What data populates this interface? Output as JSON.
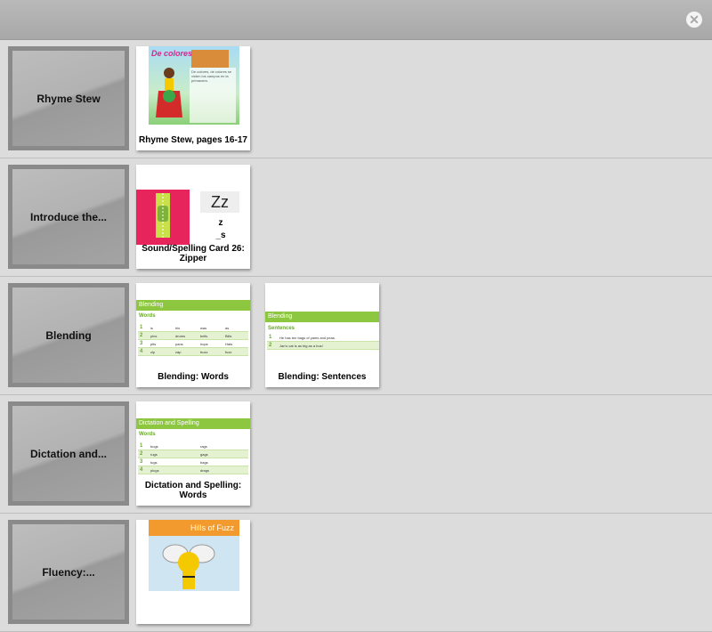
{
  "header": {
    "close_icon": "close-icon"
  },
  "rows": [
    {
      "section": "Rhyme Stew",
      "cards": [
        {
          "caption": "Rhyme Stew, pages 16-17",
          "thumb_title": "De colores"
        }
      ]
    },
    {
      "section": "Introduce the...",
      "cards": [
        {
          "caption": "Sound/Spelling Card 26: Zipper",
          "zz": "Zz",
          "letter": "z",
          "blank": "_s"
        }
      ]
    },
    {
      "section": "Blending",
      "cards": [
        {
          "caption": "Blending: Words",
          "thumb_head": "Blending",
          "thumb_sub": "Words",
          "table": [
            [
              "1",
              "is",
              "his",
              "was",
              "as"
            ],
            [
              "2",
              "pins",
              "drums",
              "bells",
              "Bills"
            ],
            [
              "3",
              "pits",
              "pans",
              "hops",
              "Hats"
            ],
            [
              "4",
              "zip",
              "zap",
              "buzz",
              "fuzz"
            ]
          ]
        },
        {
          "caption": "Blending: Sentences",
          "thumb_head": "Blending",
          "thumb_sub": "Sentences",
          "table": [
            [
              "1",
              "He has ten bags of yams and peas."
            ],
            [
              "2",
              "Jan's cat is as big as a bus!"
            ]
          ]
        }
      ]
    },
    {
      "section": "Dictation and...",
      "cards": [
        {
          "caption": "Dictation and Spelling: Words",
          "thumb_head": "Dictation and Spelling",
          "thumb_sub": "Words",
          "table": [
            [
              "1",
              "bugs",
              "rags"
            ],
            [
              "2",
              "rugs",
              "gags"
            ],
            [
              "3",
              "tugs",
              "bags"
            ],
            [
              "4",
              "plugs",
              "drags"
            ]
          ]
        }
      ]
    },
    {
      "section": "Fluency:...",
      "cards": [
        {
          "caption": "",
          "thumb_title": "Hills of Fuzz"
        }
      ]
    }
  ]
}
